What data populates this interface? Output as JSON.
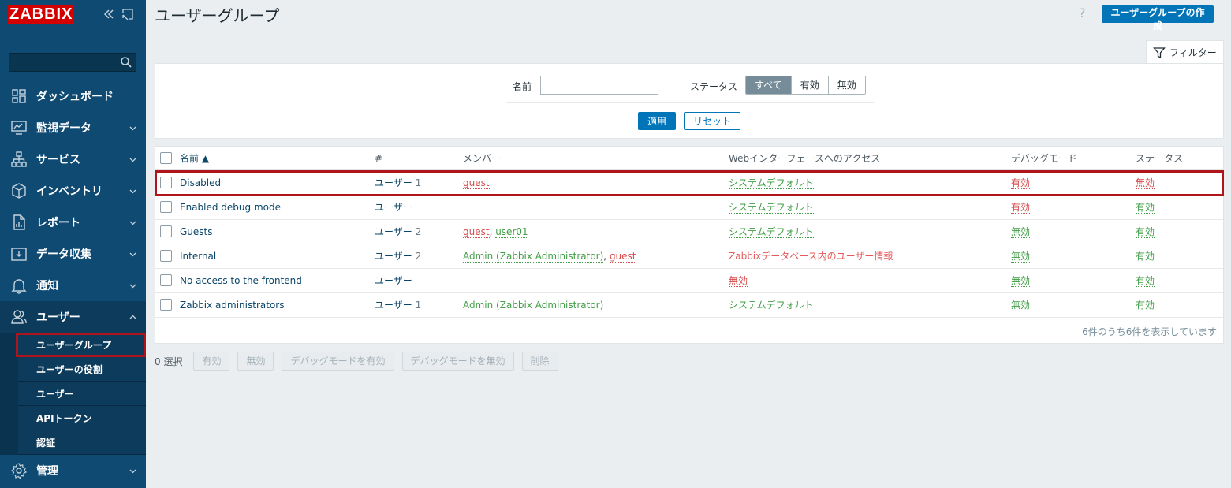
{
  "sidebar": {
    "logo": "ZABBIX",
    "nav": [
      {
        "label": "ダッシュボード",
        "icon": "dashboard-icon"
      },
      {
        "label": "監視データ",
        "icon": "monitoring-icon"
      },
      {
        "label": "サービス",
        "icon": "services-icon"
      },
      {
        "label": "インベントリ",
        "icon": "inventory-icon"
      },
      {
        "label": "レポート",
        "icon": "reports-icon"
      },
      {
        "label": "データ収集",
        "icon": "data-collection-icon"
      },
      {
        "label": "通知",
        "icon": "bell-icon"
      },
      {
        "label": "ユーザー",
        "icon": "users-icon"
      }
    ],
    "submenu": [
      "ユーザーグループ",
      "ユーザーの役割",
      "ユーザー",
      "APIトークン",
      "認証"
    ],
    "admin": {
      "label": "管理",
      "icon": "gear-icon"
    }
  },
  "header": {
    "title": "ユーザーグループ",
    "help": "?",
    "create_button": "ユーザーグループの作成"
  },
  "filter": {
    "tab_label": "フィルター",
    "name_label": "名前",
    "name_value": "",
    "status_label": "ステータス",
    "status_options": [
      "すべて",
      "有効",
      "無効"
    ],
    "status_selected": "すべて",
    "apply": "適用",
    "reset": "リセット"
  },
  "table": {
    "headers": {
      "name": "名前 ▲",
      "count": "#",
      "members": "メンバー",
      "web": "Webインターフェースへのアクセス",
      "debug": "デバッグモード",
      "status": "ステータス"
    },
    "rows": [
      {
        "name": "Disabled",
        "users": "ユーザー",
        "count": "1",
        "members": [
          {
            "text": "guest",
            "color": "red"
          }
        ],
        "web": "システムデフォルト",
        "web_color": "green",
        "debug": "有効",
        "debug_color": "red",
        "status": "無効",
        "status_color": "red"
      },
      {
        "name": "Enabled debug mode",
        "users": "ユーザー",
        "count": "",
        "members": [],
        "web": "システムデフォルト",
        "web_color": "green",
        "debug": "有効",
        "debug_color": "red",
        "status": "有効",
        "status_color": "green"
      },
      {
        "name": "Guests",
        "users": "ユーザー",
        "count": "2",
        "members": [
          {
            "text": "guest",
            "color": "red"
          },
          {
            "text": "user01",
            "color": "green"
          }
        ],
        "web": "システムデフォルト",
        "web_color": "green",
        "debug": "無効",
        "debug_color": "green",
        "status": "有効",
        "status_color": "green"
      },
      {
        "name": "Internal",
        "users": "ユーザー",
        "count": "2",
        "members": [
          {
            "text": "Admin (Zabbix Administrator)",
            "color": "green"
          },
          {
            "text": "guest",
            "color": "red"
          }
        ],
        "web": "Zabbixデータベース内のユーザー情報",
        "web_color": "orange",
        "debug": "無効",
        "debug_color": "green",
        "status": "有効",
        "status_color": "green-plain"
      },
      {
        "name": "No access to the frontend",
        "users": "ユーザー",
        "count": "",
        "members": [],
        "web": "無効",
        "web_color": "red",
        "debug": "無効",
        "debug_color": "green",
        "status": "有効",
        "status_color": "green"
      },
      {
        "name": "Zabbix administrators",
        "users": "ユーザー",
        "count": "1",
        "members": [
          {
            "text": "Admin (Zabbix Administrator)",
            "color": "green"
          }
        ],
        "web": "システムデフォルト",
        "web_color": "green-plain",
        "debug": "無効",
        "debug_color": "green",
        "status": "有効",
        "status_color": "green-plain"
      }
    ],
    "footer": "6件のうち6件を表示しています"
  },
  "actions": {
    "selected": "0 選択",
    "buttons": [
      "有効",
      "無効",
      "デバッグモードを有効",
      "デバッグモードを無効",
      "削除"
    ]
  },
  "colors": {
    "sidebar": "#0f4a73",
    "primary": "#0275b8",
    "highlight": "#b0141b",
    "green": "#429e47",
    "red": "#d64e4e"
  }
}
